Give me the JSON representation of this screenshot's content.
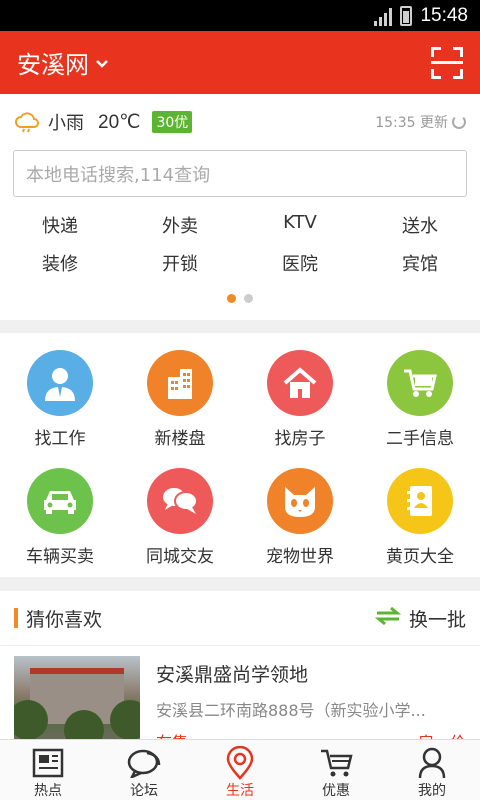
{
  "status_bar": {
    "time": "15:48"
  },
  "app_bar": {
    "title": "安溪网",
    "chevron": "⌄"
  },
  "weather": {
    "desc": "小雨",
    "temp": "20℃",
    "aqi": "30优",
    "update": "15:35 更新"
  },
  "search": {
    "placeholder": "本地电话搜索,114查询"
  },
  "quick_links": [
    "快递",
    "外卖",
    "KTV",
    "送水",
    "装修",
    "开锁",
    "医院",
    "宾馆"
  ],
  "categories": [
    {
      "label": "找工作",
      "color": "#5aaee6",
      "icon": "person-icon"
    },
    {
      "label": "新楼盘",
      "color": "#f0822a",
      "icon": "building-icon"
    },
    {
      "label": "找房子",
      "color": "#ee5a5a",
      "icon": "house-icon"
    },
    {
      "label": "二手信息",
      "color": "#8cc63e",
      "icon": "cart-icon"
    },
    {
      "label": "车辆买卖",
      "color": "#6cc24a",
      "icon": "car-icon"
    },
    {
      "label": "同城交友",
      "color": "#ee5a5a",
      "icon": "chat-icon"
    },
    {
      "label": "宠物世界",
      "color": "#f0822a",
      "icon": "cat-icon"
    },
    {
      "label": "黄页大全",
      "color": "#f5c518",
      "icon": "contacts-icon"
    }
  ],
  "recommend": {
    "title": "猜你喜欢",
    "swap": "换一批",
    "item": {
      "name": "安溪鼎盛尚学领地",
      "addr": "安溪县二环南路888号（新实验小学...",
      "status": "在售",
      "price": "一房一价"
    }
  },
  "tabs": [
    {
      "label": "热点",
      "icon": "news-icon"
    },
    {
      "label": "论坛",
      "icon": "forum-icon"
    },
    {
      "label": "生活",
      "icon": "location-icon"
    },
    {
      "label": "优惠",
      "icon": "cart-icon"
    },
    {
      "label": "我的",
      "icon": "user-icon"
    }
  ],
  "colors": {
    "brand": "#e8341f",
    "accent": "#f08a24",
    "aqi": "#5cb531"
  }
}
